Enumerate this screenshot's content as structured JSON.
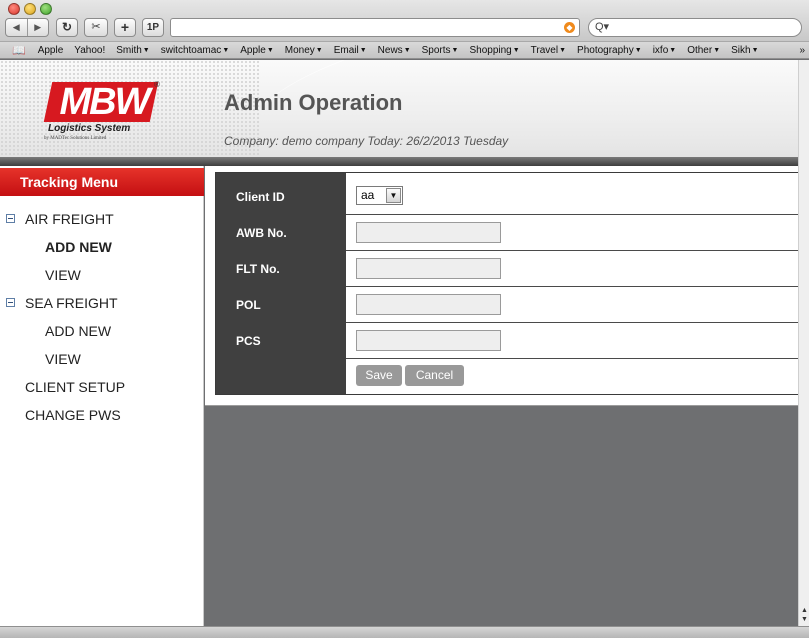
{
  "browser": {
    "back_glyph": "◀",
    "forward_glyph": "▶",
    "reload_glyph": "↻",
    "snapshot_glyph": "✂",
    "add_glyph": "+",
    "onepassword_label": "1P",
    "url_value": "",
    "search_glyph": "Q▾",
    "rss_glyph": "◆",
    "bookmarks_glyph": "📖",
    "bookmarks": [
      {
        "label": "Apple",
        "arrow": ""
      },
      {
        "label": "Yahoo!",
        "arrow": ""
      },
      {
        "label": "Smith",
        "arrow": "▼"
      },
      {
        "label": "switchtoamac",
        "arrow": "▼"
      },
      {
        "label": "Apple",
        "arrow": "▼"
      },
      {
        "label": "Money",
        "arrow": "▼"
      },
      {
        "label": "Email",
        "arrow": "▼"
      },
      {
        "label": "News",
        "arrow": "▼"
      },
      {
        "label": "Sports",
        "arrow": "▼"
      },
      {
        "label": "Shopping",
        "arrow": "▼"
      },
      {
        "label": "Travel",
        "arrow": "▼"
      },
      {
        "label": "Photography",
        "arrow": "▼"
      },
      {
        "label": "ixfo",
        "arrow": "▼"
      },
      {
        "label": "Other",
        "arrow": "▼"
      },
      {
        "label": "Sikh",
        "arrow": "▼"
      }
    ],
    "bookmarks_more": "»"
  },
  "header": {
    "logo_text": "MBW",
    "logo_registered": "®",
    "logo_subtitle": "Logistics System",
    "logo_byline": "by MADTec Solutions Limited",
    "title": "Admin Operation",
    "company_line": "Company: demo company Today: 26/2/2013 Tuesday"
  },
  "sidebar": {
    "title": "Tracking Menu",
    "items": [
      {
        "label": "AIR FREIGHT"
      },
      {
        "label": "ADD NEW"
      },
      {
        "label": "VIEW"
      },
      {
        "label": "SEA FREIGHT"
      },
      {
        "label": "ADD NEW"
      },
      {
        "label": "VIEW"
      },
      {
        "label": "CLIENT SETUP"
      },
      {
        "label": "CHANGE PWS"
      }
    ]
  },
  "form": {
    "client_id_label": "Client ID",
    "client_id_value": "aa",
    "select_arrow": "▼",
    "awb_label": "AWB No.",
    "awb_value": "",
    "flt_label": "FLT No.",
    "flt_value": "",
    "pol_label": "POL",
    "pol_value": "",
    "pcs_label": "PCS",
    "pcs_value": "",
    "save_label": "Save",
    "cancel_label": "Cancel"
  },
  "scrollbar": {
    "up_glyph": "▲",
    "down_glyph": "▼"
  },
  "colors": {
    "brand_red": "#d71920",
    "menu_red": "#e6332a",
    "label_column": "#404040",
    "page_background": "#6e6f71",
    "button_gray": "#999999"
  }
}
